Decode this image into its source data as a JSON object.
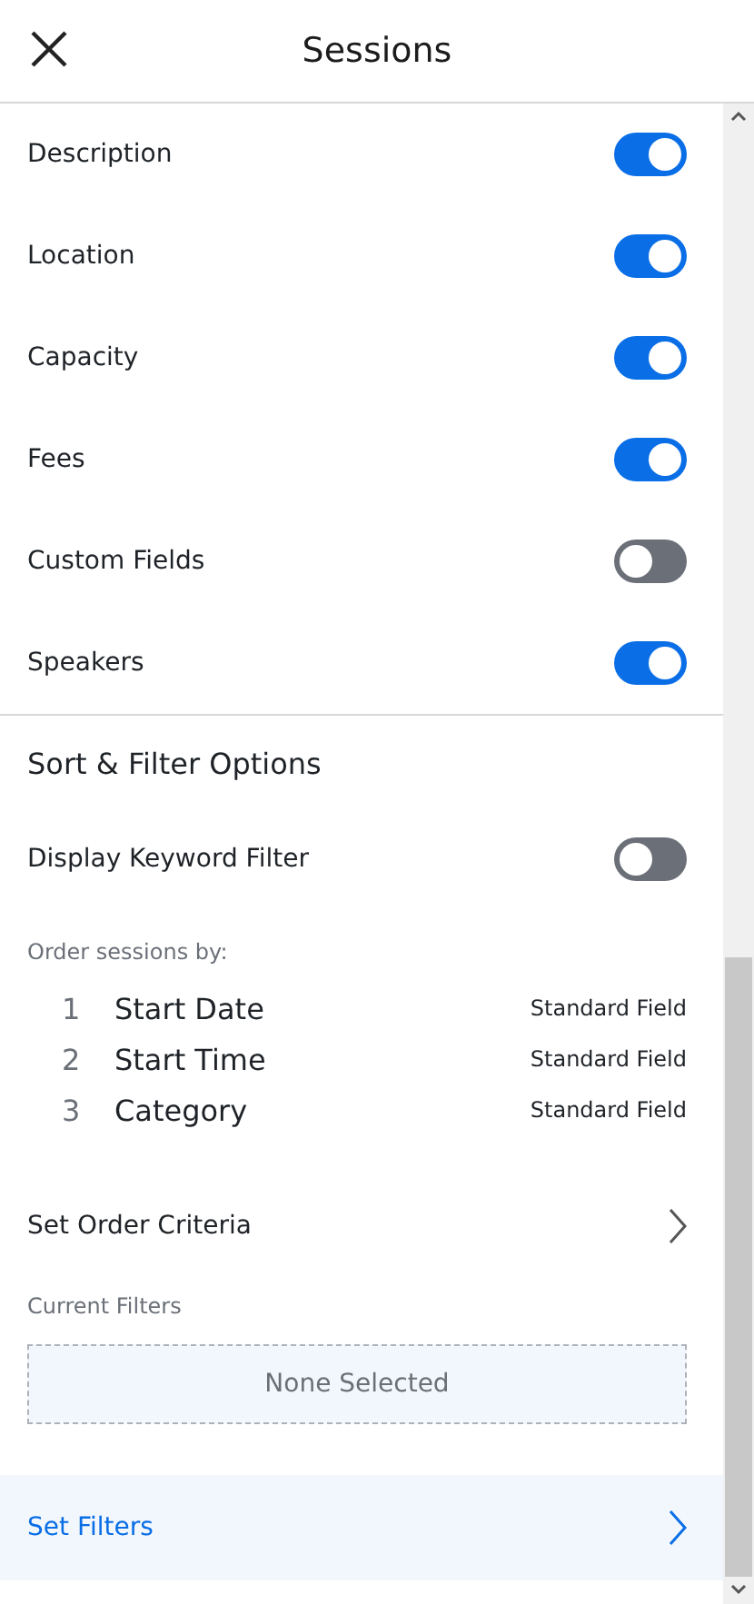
{
  "header": {
    "title": "Sessions"
  },
  "toggles": [
    {
      "label": "Description",
      "on": true
    },
    {
      "label": "Location",
      "on": true
    },
    {
      "label": "Capacity",
      "on": true
    },
    {
      "label": "Fees",
      "on": true
    },
    {
      "label": "Custom Fields",
      "on": false
    },
    {
      "label": "Speakers",
      "on": true
    }
  ],
  "sort_filter": {
    "title": "Sort & Filter Options",
    "keyword_toggle": {
      "label": "Display Keyword Filter",
      "on": false
    },
    "order_label": "Order sessions by:",
    "order_items": [
      {
        "number": "1",
        "name": "Start Date",
        "type": "Standard Field"
      },
      {
        "number": "2",
        "name": "Start Time",
        "type": "Standard Field"
      },
      {
        "number": "3",
        "name": "Category",
        "type": "Standard Field"
      }
    ],
    "order_link": {
      "label": "Set Order Criteria",
      "highlighted": false
    },
    "filters_label": "Current Filters",
    "filters_empty": "None Selected",
    "filters_link": {
      "label": "Set Filters",
      "highlighted": true
    }
  }
}
